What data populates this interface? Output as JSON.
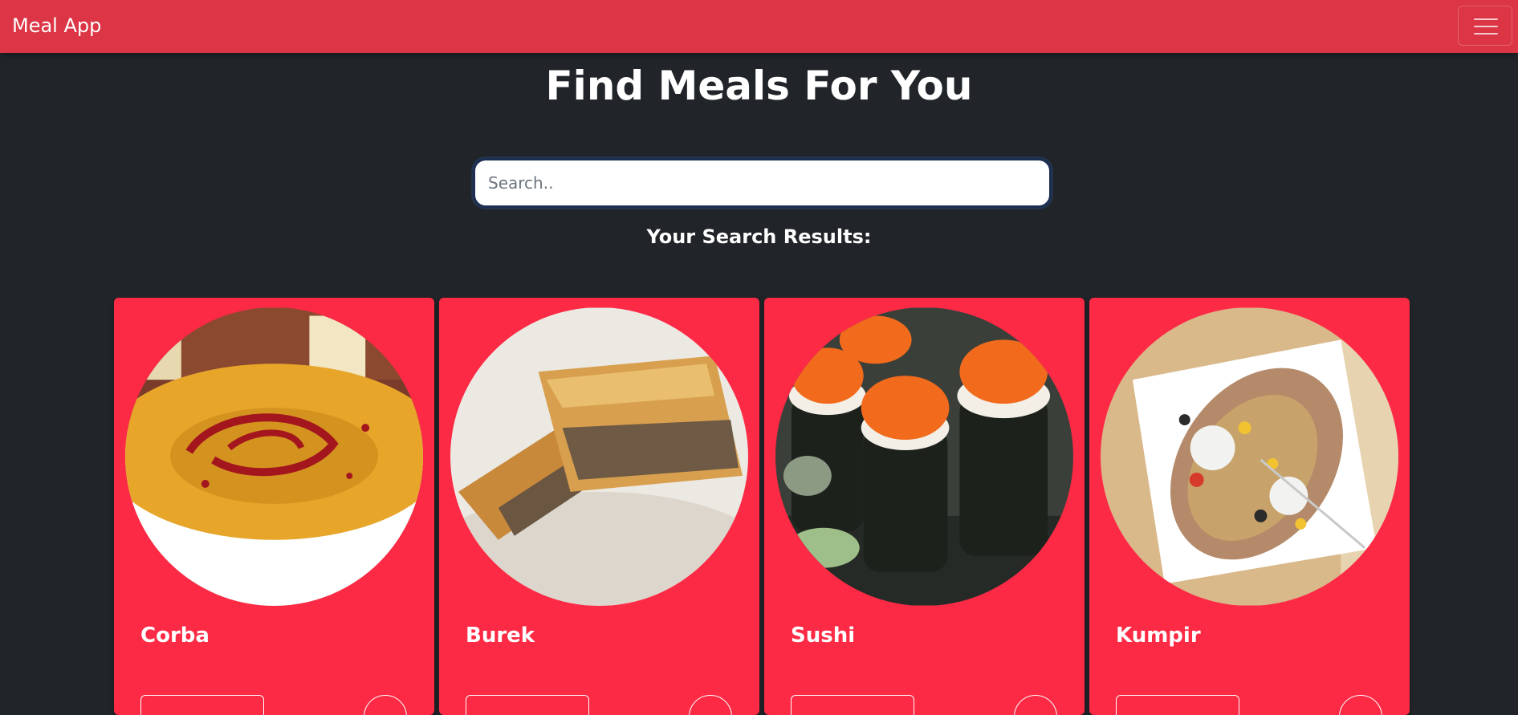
{
  "navbar": {
    "brand": "Meal App",
    "menu_icon": "hamburger-menu-icon"
  },
  "main": {
    "heading": "Find Meals For You",
    "search": {
      "placeholder": "Search..",
      "value": ""
    },
    "results_label": "Your Search Results:"
  },
  "meals": [
    {
      "name": "Corba",
      "image": "soup-bowl-photo"
    },
    {
      "name": "Burek",
      "image": "pastry-pie-photo"
    },
    {
      "name": "Sushi",
      "image": "sushi-rolls-photo"
    },
    {
      "name": "Kumpir",
      "image": "stuffed-potato-photo"
    }
  ],
  "colors": {
    "navbar": "#dc3545",
    "background": "#212529",
    "card": "#fd2a45",
    "text": "#ffffff"
  }
}
